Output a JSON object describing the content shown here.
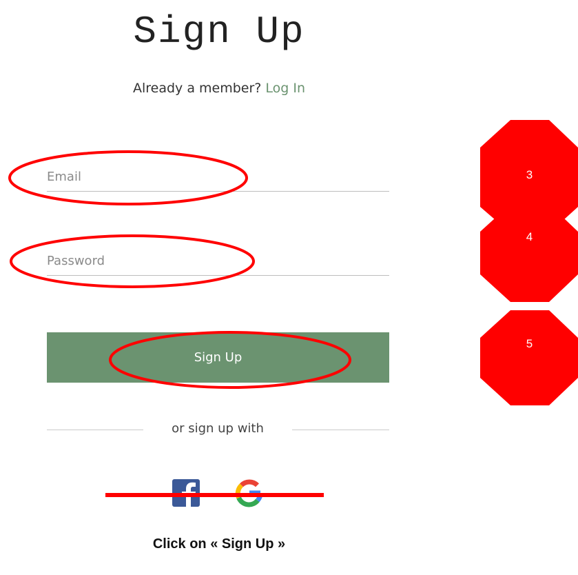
{
  "header": {
    "title": "Sign Up",
    "member_prompt": "Already a member?",
    "login_link": "Log In"
  },
  "form": {
    "email_placeholder": "Email",
    "password_placeholder": "Password",
    "submit_label": "Sign Up",
    "divider_text": "or sign up with"
  },
  "social": [
    {
      "icon": "facebook-icon",
      "label": "f",
      "color": "#3b5998"
    },
    {
      "icon": "google-icon",
      "label": "G",
      "colors": [
        "#ea4335",
        "#fbbc05",
        "#34a853",
        "#4285f4"
      ]
    }
  ],
  "annotations": {
    "steps": [
      "3",
      "4",
      "5"
    ],
    "highlight_color": "#ff0000",
    "instruction": "Click on « Sign Up »"
  },
  "colors": {
    "accent": "#6b9370",
    "text": "#333333",
    "divider": "#c9c9c9"
  }
}
